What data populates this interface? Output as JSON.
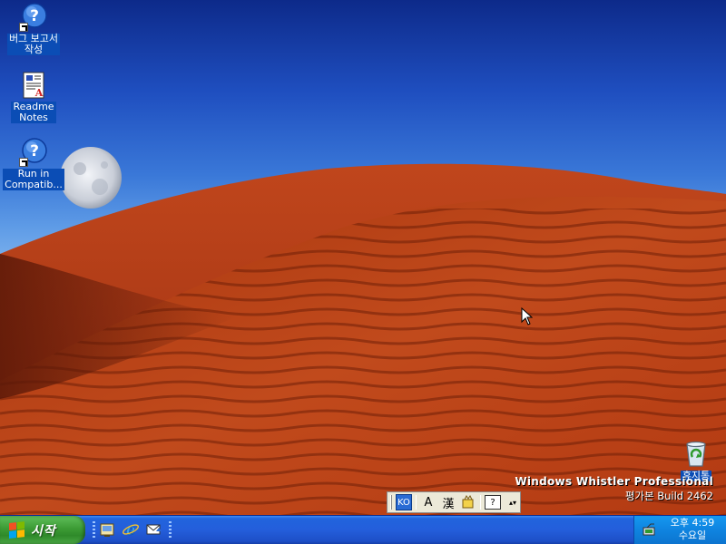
{
  "desktop": {
    "icons": [
      {
        "name": "bug-report",
        "label": "버그 보고서\n작성",
        "icon": "help-shortcut-icon"
      },
      {
        "name": "readme-notes",
        "label": "Readme\nNotes",
        "icon": "document-icon"
      },
      {
        "name": "run-in-compat",
        "label": "Run in\nCompatib...",
        "icon": "help-shortcut-icon"
      },
      {
        "name": "recycle-bin",
        "label": "휴지통",
        "icon": "recycle-bin-icon"
      }
    ],
    "watermark": {
      "title": "Windows Whistler Professional",
      "build": "평가본  Build 2462"
    }
  },
  "language_bar": {
    "ime": "KO",
    "mode": "A",
    "hanja": "漢",
    "help": "?",
    "menu": "▴▾"
  },
  "taskbar": {
    "start_label": "시작",
    "quick_launch": [
      "desktop-icon",
      "internet-explorer-icon",
      "outlook-express-icon"
    ],
    "clock": {
      "time": "오후 4:59",
      "day": "수요일"
    }
  },
  "colors": {
    "taskbar": "#245edb",
    "start_button": "#3c9b35",
    "tray": "#0f84e0",
    "selection": "#0b4db5"
  }
}
